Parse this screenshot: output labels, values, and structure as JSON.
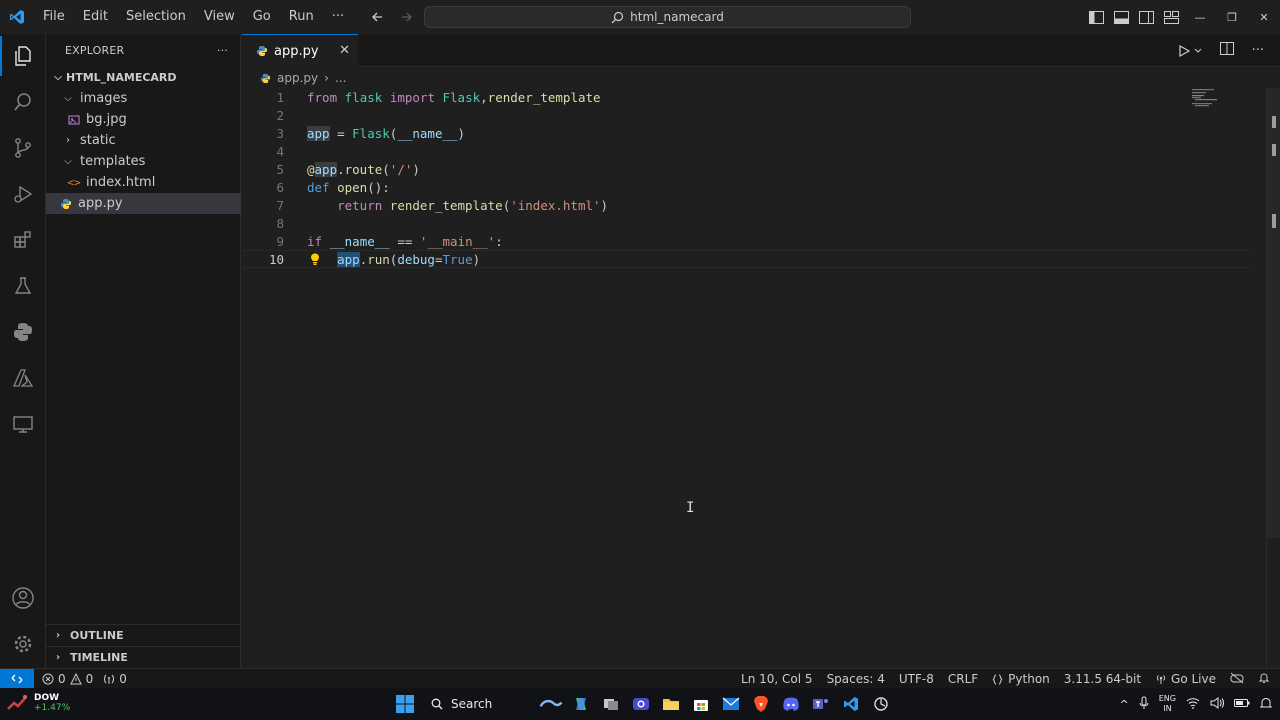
{
  "titlebar": {
    "menu": [
      "File",
      "Edit",
      "Selection",
      "View",
      "Go",
      "Run",
      "···"
    ],
    "command_center": "html_namecard"
  },
  "sidebar": {
    "title": "EXPLORER",
    "more": "···",
    "root": "HTML_NAMECARD",
    "tree": [
      {
        "label": "images",
        "type": "folder",
        "open": true,
        "depth": 1
      },
      {
        "label": "bg.jpg",
        "type": "image",
        "depth": 2
      },
      {
        "label": "static",
        "type": "folder",
        "open": false,
        "depth": 1
      },
      {
        "label": "templates",
        "type": "folder",
        "open": true,
        "depth": 1
      },
      {
        "label": "index.html",
        "type": "html",
        "depth": 2
      },
      {
        "label": "app.py",
        "type": "python",
        "depth": 1,
        "selected": true
      }
    ],
    "outline": "OUTLINE",
    "timeline": "TIMELINE"
  },
  "editor": {
    "tab_label": "app.py",
    "breadcrumb_file": "app.py",
    "breadcrumb_more": "...",
    "line_numbers": [
      "1",
      "2",
      "3",
      "4",
      "5",
      "6",
      "7",
      "8",
      "9",
      "10"
    ],
    "current_line": 10
  },
  "statusbar": {
    "errors": "0",
    "warnings": "0",
    "ports": "0",
    "position": "Ln 10, Col 5",
    "indent": "Spaces: 4",
    "encoding": "UTF-8",
    "eol": "CRLF",
    "language": "Python",
    "interpreter": "3.11.5 64-bit",
    "live": "Go Live"
  },
  "taskbar": {
    "ticker": "DOW",
    "ticker_change": "+1.47%",
    "search": "Search",
    "lang_top": "ENG",
    "lang_bottom": "IN"
  },
  "colors": {
    "accent": "#0078d4",
    "keyword": "#c586c0",
    "string": "#ce9178",
    "function": "#dcdcaa",
    "class": "#4ec9b0"
  }
}
